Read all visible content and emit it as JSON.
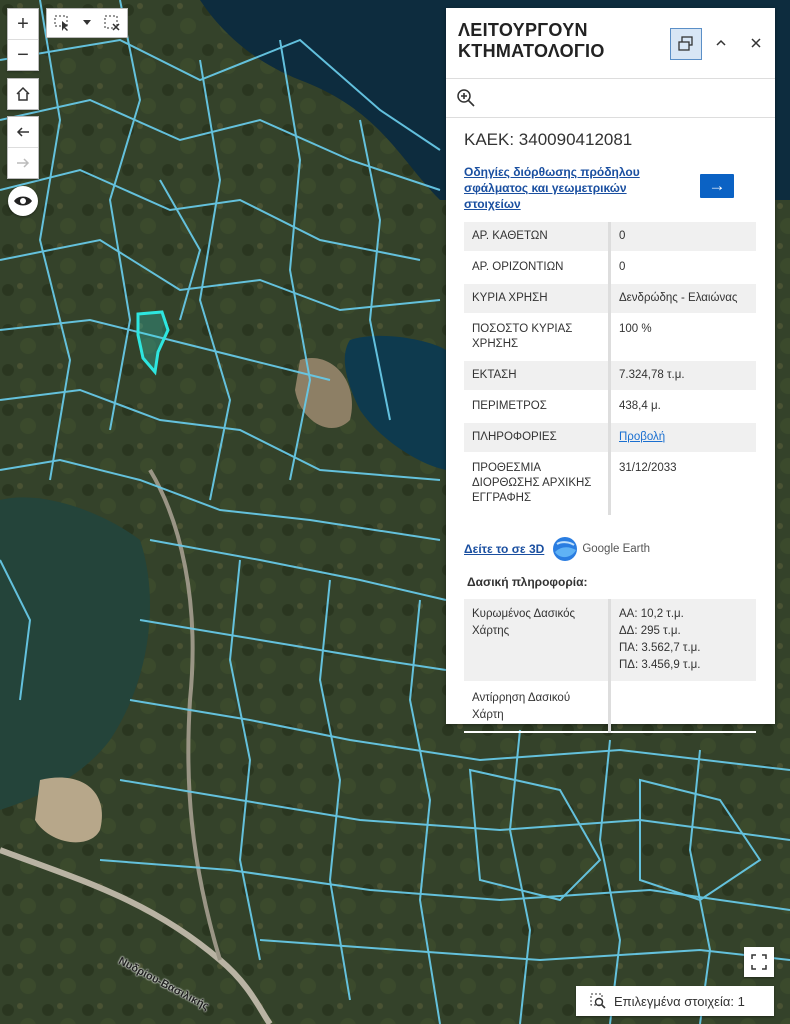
{
  "map": {
    "road_label": "Νυδρίου-Βασιλικής",
    "colors": {
      "parcel_outline": "#67c8e6",
      "selected_parcel": "#2ee6e0",
      "water": "#0c2a3a",
      "vegetation": "#2f3d24"
    }
  },
  "toolbar": {
    "zoom_in": "+",
    "zoom_out": "−"
  },
  "panel": {
    "title": "ΛΕΙΤΟΥΡΓΟΥΝ ΚΤΗΜΑΤΟΛΟΓΙΟ",
    "kaek": "ΚΑΕΚ: 340090412081",
    "guide_link": "Οδηγίες διόρθωσης πρόδηλου σφάλματος και γεωμετρικών στοιχείων",
    "attributes": [
      {
        "key": "ΑΡ. ΚΑΘΕΤΩΝ",
        "value": "0"
      },
      {
        "key": "ΑΡ. ΟΡΙΖΟΝΤΙΩΝ",
        "value": "0"
      },
      {
        "key": "ΚΥΡΙΑ ΧΡΗΣΗ",
        "value": "Δενδρώδης - Ελαιώνας"
      },
      {
        "key": "ΠΟΣΟΣΤΟ ΚΥΡΙΑΣ ΧΡΗΣΗΣ",
        "value": "100 %"
      },
      {
        "key": "ΕΚΤΑΣΗ",
        "value": "7.324,78 τ.μ."
      },
      {
        "key": "ΠΕΡΙΜΕΤΡΟΣ",
        "value": "438,4 μ."
      },
      {
        "key": "ΠΛΗΡΟΦΟΡΙΕΣ",
        "value": "Προβολή"
      },
      {
        "key": "ΠΡΟΘΕΣΜΙΑ ΔΙΟΡΘΩΣΗΣ ΑΡΧΙΚΗΣ ΕΓΓΡΑΦΗΣ",
        "value": "31/12/2033"
      }
    ],
    "earth_link": "Δείτε το σε 3D",
    "earth_brand": "Google Earth",
    "forest_title": "Δασική πληροφορία:",
    "forest": [
      {
        "key": "Κυρωμένος Δασικός Χάρτης",
        "lines": [
          "ΑΑ: 10,2 τ.μ.",
          "ΔΔ: 295 τ.μ.",
          "ΠΑ: 3.562,7 τ.μ.",
          "ΠΔ: 3.456,9 τ.μ."
        ]
      },
      {
        "key": "Αντίρρηση Δασικού Χάρτη",
        "lines": []
      }
    ]
  },
  "status": {
    "selected_label": "Επιλεγμένα στοιχεία: 1"
  }
}
